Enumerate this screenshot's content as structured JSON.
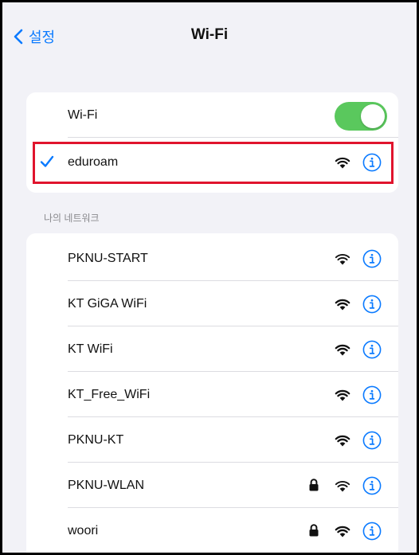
{
  "nav": {
    "back_label": "설정",
    "title": "Wi-Fi"
  },
  "wifi_toggle": {
    "label": "Wi-Fi",
    "on": true
  },
  "connected_network": {
    "name": "eduroam",
    "selected": true,
    "signal": "strong"
  },
  "my_networks": {
    "header": "나의 네트워크",
    "items": [
      {
        "name": "PKNU-START",
        "secured": false,
        "signal": "medium"
      },
      {
        "name": "KT GiGA WiFi",
        "secured": false,
        "signal": "strong"
      },
      {
        "name": "KT WiFi",
        "secured": false,
        "signal": "strong"
      },
      {
        "name": "KT_Free_WiFi",
        "secured": false,
        "signal": "strong"
      },
      {
        "name": "PKNU-KT",
        "secured": false,
        "signal": "strong"
      },
      {
        "name": "PKNU-WLAN",
        "secured": true,
        "signal": "medium"
      },
      {
        "name": "woori",
        "secured": true,
        "signal": "strong"
      }
    ]
  },
  "colors": {
    "accent": "#0a7aff",
    "toggle_on": "#5ac85d",
    "highlight": "#e0142d"
  }
}
